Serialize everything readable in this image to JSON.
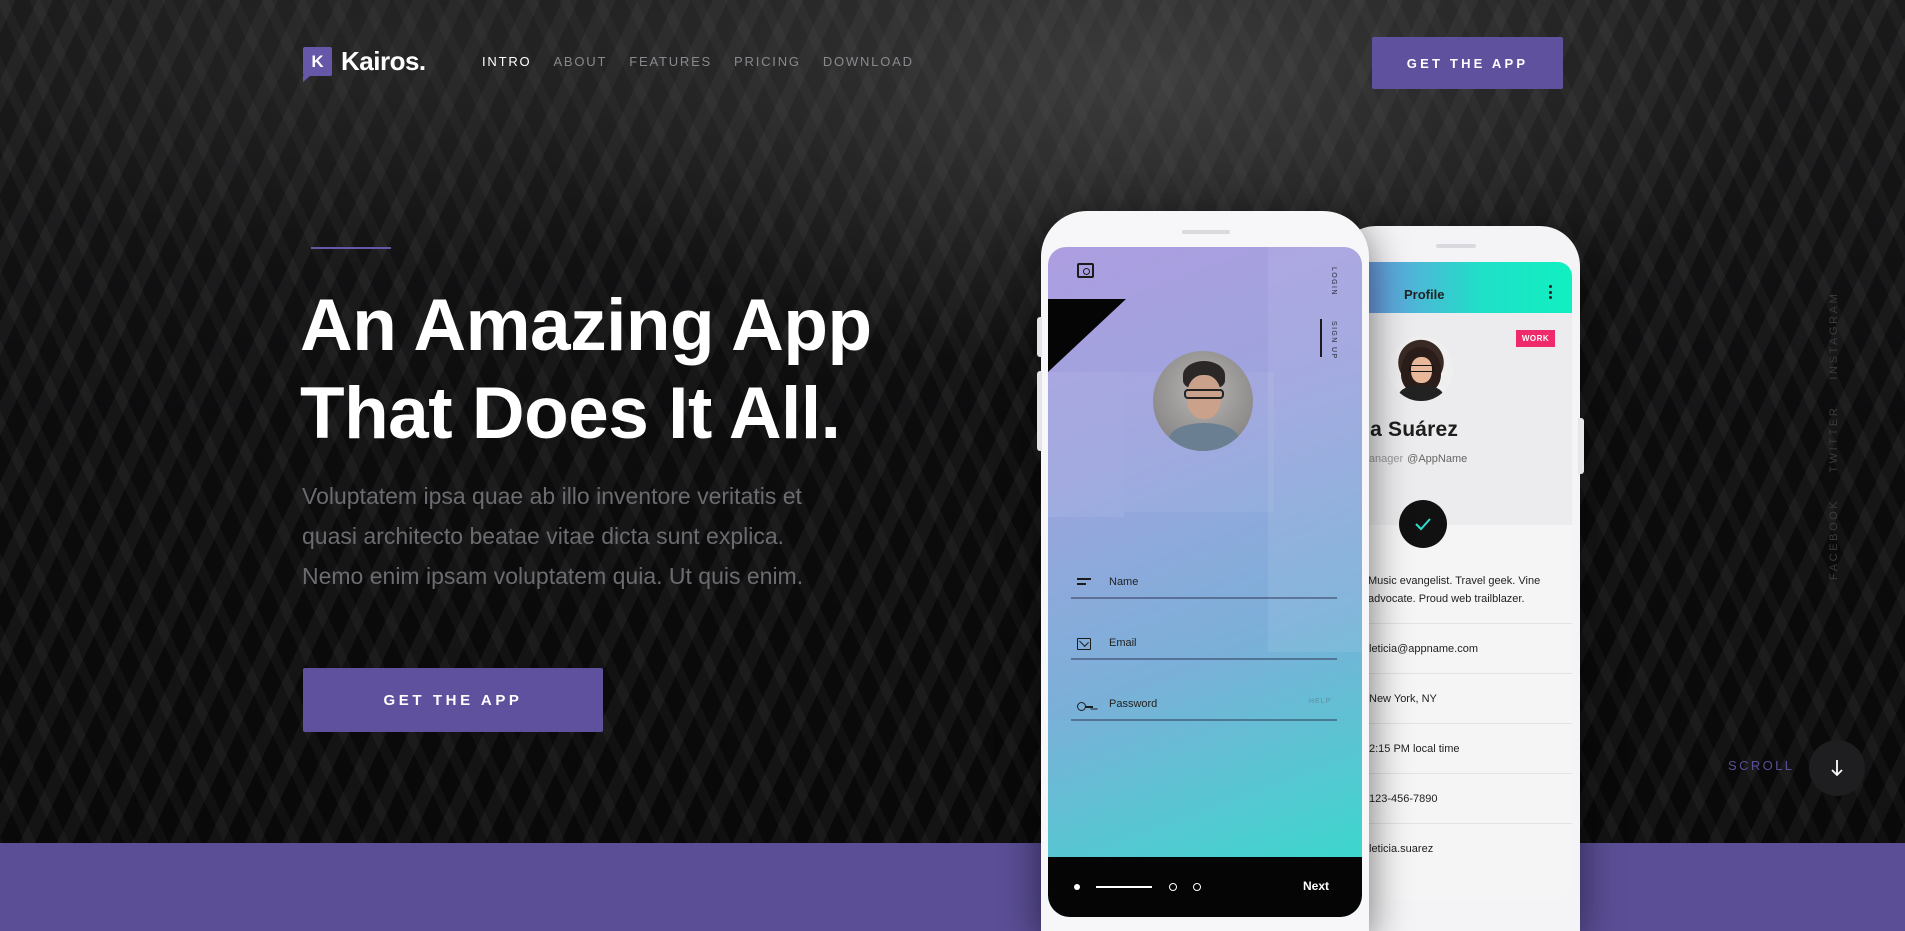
{
  "header": {
    "logo_letter": "K",
    "logo_text": "Kairos.",
    "nav": [
      {
        "label": "INTRO",
        "active": true
      },
      {
        "label": "ABOUT"
      },
      {
        "label": "FEATURES"
      },
      {
        "label": "PRICING"
      },
      {
        "label": "DOWNLOAD"
      }
    ],
    "cta_label": "GET THE APP"
  },
  "hero": {
    "headline_line1": "An Amazing App",
    "headline_line2": "That Does It All.",
    "sub_line1": "Voluptatem ipsa quae ab illo inventore veritatis et",
    "sub_line2": "quasi architecto beatae vitae dicta sunt explica.",
    "sub_line3": "Nemo enim ipsam voluptatem quia. Ut quis enim.",
    "cta_label": "GET THE APP"
  },
  "social": [
    "FACEBOOK",
    "TWITTER",
    "INSTAGRAM"
  ],
  "scroll_label": "SCROLL",
  "login_screen": {
    "tab_login": "LOGIN",
    "tab_signup": "SIGN UP",
    "field_name": "Name",
    "field_email": "Email",
    "field_password": "Password",
    "help": "HELP",
    "next": "Next"
  },
  "profile_screen": {
    "title": "Profile",
    "badge": "WORK",
    "name": "ticia Suárez",
    "role": "uct Manager",
    "handle": "@AppName",
    "bio": "Music evangelist. Travel geek. Vine advocate. Proud web trailblazer.",
    "rows": [
      "leticia@appname.com",
      "New York, NY",
      "2:15 PM local time",
      "123-456-7890",
      "leticia.suarez"
    ]
  },
  "colors": {
    "accent": "#5f519e",
    "band": "#5b4e96",
    "badge": "#ee2a6b",
    "gradient_end": "#2ee0cb"
  }
}
